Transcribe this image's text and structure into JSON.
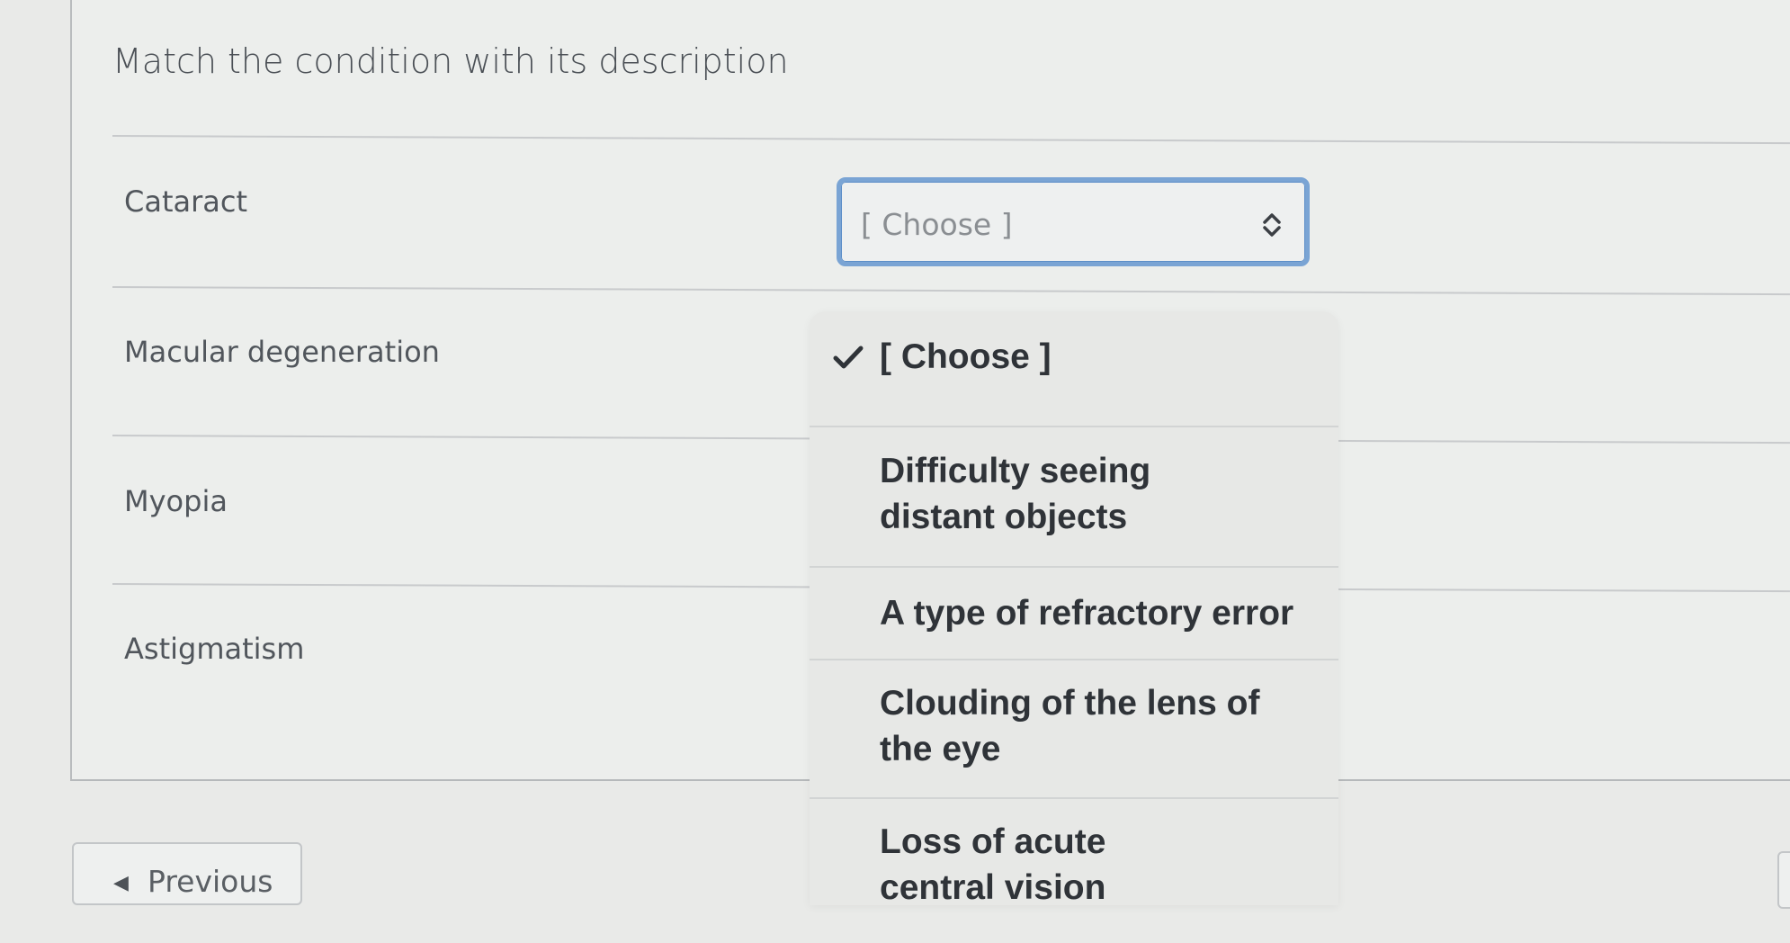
{
  "question": {
    "title": "Match the condition with its description"
  },
  "conditions": [
    {
      "label": "Cataract"
    },
    {
      "label": "Macular degeneration"
    },
    {
      "label": "Myopia"
    },
    {
      "label": "Astigmatism"
    }
  ],
  "select": {
    "value": "[ Choose ]",
    "icon": "chevron-up-down-icon"
  },
  "dropdown": {
    "options": [
      {
        "label": "[ Choose ]",
        "selected": true,
        "line1": "[ Choose ]",
        "line2": ""
      },
      {
        "label": "Difficulty seeing distant objects",
        "selected": false,
        "line1": "Difficulty seeing",
        "line2": "distant objects"
      },
      {
        "label": "A type of refractory error",
        "selected": false,
        "line1": "A type of refractory error",
        "line2": ""
      },
      {
        "label": "Clouding of the lens of the eye",
        "selected": false,
        "line1": "Clouding of the lens of",
        "line2": "the eye"
      },
      {
        "label": "Loss of acute central vision",
        "selected": false,
        "line1": "Loss of acute",
        "line2": "central vision"
      }
    ],
    "check_icon": "checkmark-icon"
  },
  "navigation": {
    "previous_label": "Previous",
    "previous_icon": "triangle-left-icon"
  },
  "colors": {
    "focus_border": "#7aa4d4",
    "background": "#e9eae8"
  }
}
